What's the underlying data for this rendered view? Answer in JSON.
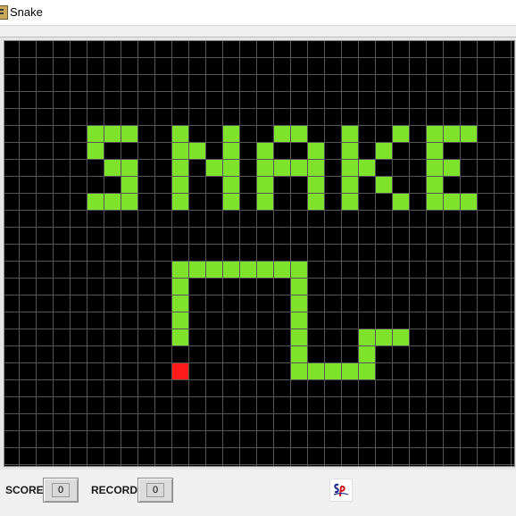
{
  "window": {
    "title": "Snake",
    "icon": "game-app-icon"
  },
  "colors": {
    "snake": "#7ee32a",
    "food": "#ff1a1a",
    "board": "#000000",
    "grid": "#555555"
  },
  "board": {
    "cols": 30,
    "rows": 25,
    "title_pixels": [
      [
        5,
        5
      ],
      [
        6,
        5
      ],
      [
        7,
        5
      ],
      [
        10,
        5
      ],
      [
        13,
        5
      ],
      [
        16,
        5
      ],
      [
        17,
        5
      ],
      [
        20,
        5
      ],
      [
        23,
        5
      ],
      [
        25,
        5
      ],
      [
        26,
        5
      ],
      [
        27,
        5
      ],
      [
        5,
        6
      ],
      [
        10,
        6
      ],
      [
        11,
        6
      ],
      [
        13,
        6
      ],
      [
        15,
        6
      ],
      [
        18,
        6
      ],
      [
        20,
        6
      ],
      [
        22,
        6
      ],
      [
        25,
        6
      ],
      [
        6,
        7
      ],
      [
        7,
        7
      ],
      [
        10,
        7
      ],
      [
        12,
        7
      ],
      [
        13,
        7
      ],
      [
        15,
        7
      ],
      [
        16,
        7
      ],
      [
        17,
        7
      ],
      [
        18,
        7
      ],
      [
        20,
        7
      ],
      [
        21,
        7
      ],
      [
        25,
        7
      ],
      [
        26,
        7
      ],
      [
        7,
        8
      ],
      [
        10,
        8
      ],
      [
        13,
        8
      ],
      [
        15,
        8
      ],
      [
        18,
        8
      ],
      [
        20,
        8
      ],
      [
        22,
        8
      ],
      [
        25,
        8
      ],
      [
        5,
        9
      ],
      [
        6,
        9
      ],
      [
        7,
        9
      ],
      [
        10,
        9
      ],
      [
        13,
        9
      ],
      [
        15,
        9
      ],
      [
        18,
        9
      ],
      [
        20,
        9
      ],
      [
        23,
        9
      ],
      [
        25,
        9
      ],
      [
        26,
        9
      ],
      [
        27,
        9
      ]
    ],
    "snake": [
      [
        10,
        17
      ],
      [
        10,
        16
      ],
      [
        10,
        15
      ],
      [
        10,
        14
      ],
      [
        10,
        13
      ],
      [
        11,
        13
      ],
      [
        12,
        13
      ],
      [
        13,
        13
      ],
      [
        14,
        13
      ],
      [
        15,
        13
      ],
      [
        16,
        13
      ],
      [
        17,
        13
      ],
      [
        17,
        14
      ],
      [
        17,
        15
      ],
      [
        17,
        16
      ],
      [
        17,
        17
      ],
      [
        17,
        18
      ],
      [
        17,
        19
      ],
      [
        18,
        19
      ],
      [
        19,
        19
      ],
      [
        20,
        19
      ],
      [
        21,
        19
      ],
      [
        21,
        18
      ],
      [
        21,
        17
      ],
      [
        22,
        17
      ],
      [
        23,
        17
      ]
    ],
    "food": [
      10,
      19
    ]
  },
  "footer": {
    "score_label": "SCORE",
    "score_value": "0",
    "record_label": "RECORD",
    "record_value": "0",
    "logo_text": "SP"
  }
}
